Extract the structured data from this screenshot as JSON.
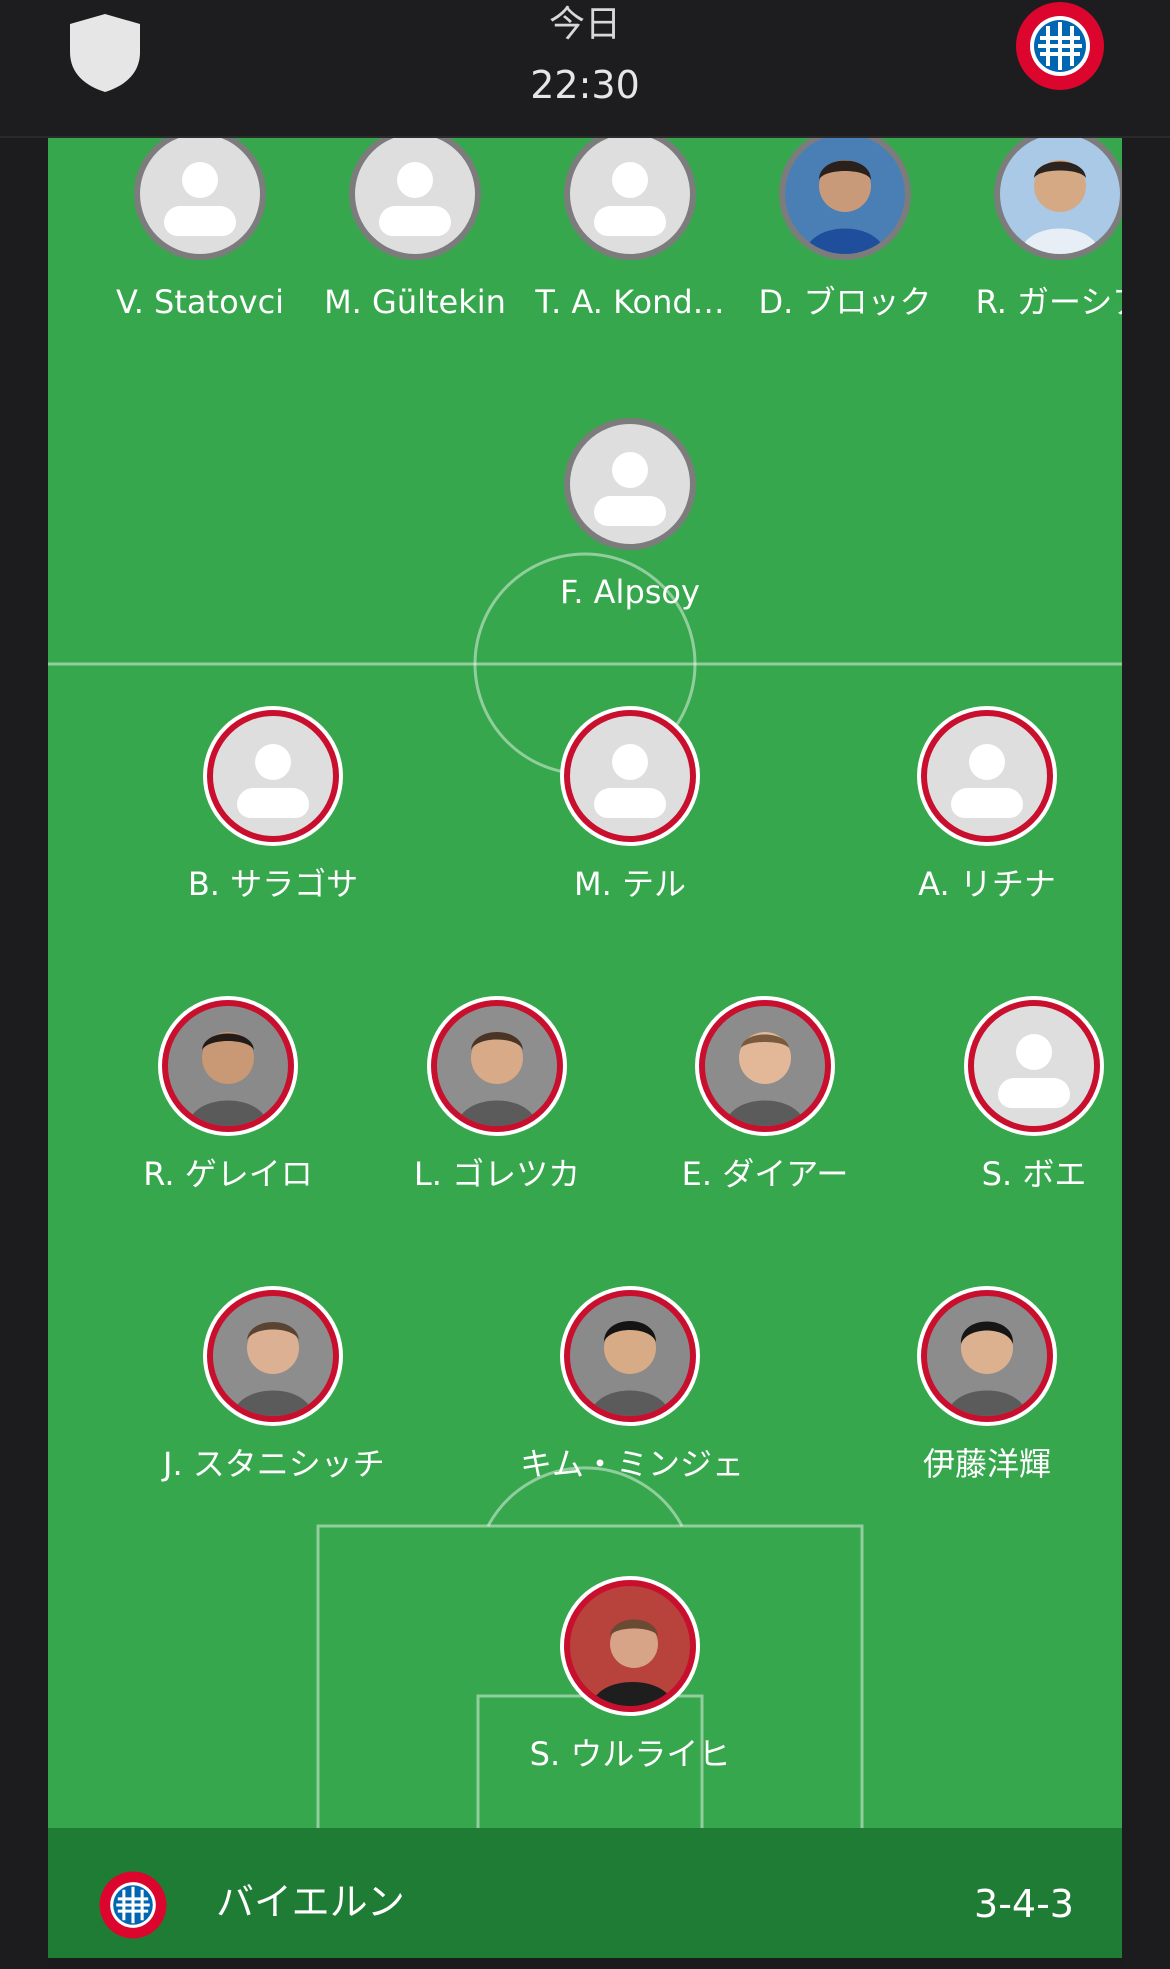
{
  "header": {
    "day": "今日",
    "time": "22:30",
    "away_icon": "shield-icon",
    "home_icon": "bayern-crest-icon"
  },
  "away_team": {
    "players": [
      {
        "name": "V. Statovci",
        "photo": false
      },
      {
        "name": "M. Gültekin",
        "photo": false
      },
      {
        "name": "T. A. Kond…",
        "photo": false
      },
      {
        "name": "D. ブロック",
        "photo": true
      },
      {
        "name": "R. ガーシア",
        "photo": true
      },
      {
        "name": "F. Alpsoy",
        "photo": false
      }
    ]
  },
  "home_team": {
    "name": "バイエルン",
    "formation": "3-4-3",
    "players": [
      {
        "name": "B. サラゴサ",
        "photo": false
      },
      {
        "name": "M. テル",
        "photo": false
      },
      {
        "name": "A. リチナ",
        "photo": false
      },
      {
        "name": "R. ゲレイロ",
        "photo": true
      },
      {
        "name": "L. ゴレツカ",
        "photo": true
      },
      {
        "name": "E. ダイアー",
        "photo": true
      },
      {
        "name": "S. ボエ",
        "photo": false
      },
      {
        "name": "J. スタニシッチ",
        "photo": true
      },
      {
        "name": "キム・ミンジェ",
        "photo": true
      },
      {
        "name": "伊藤洋輝",
        "photo": true
      },
      {
        "name": "S. ウルライヒ",
        "photo": true
      }
    ]
  },
  "colors": {
    "pitch": "#37a74d",
    "team_bar": "#1e7c35",
    "home_ring": "#c8102e",
    "away_ring": "#7c7c7c"
  }
}
